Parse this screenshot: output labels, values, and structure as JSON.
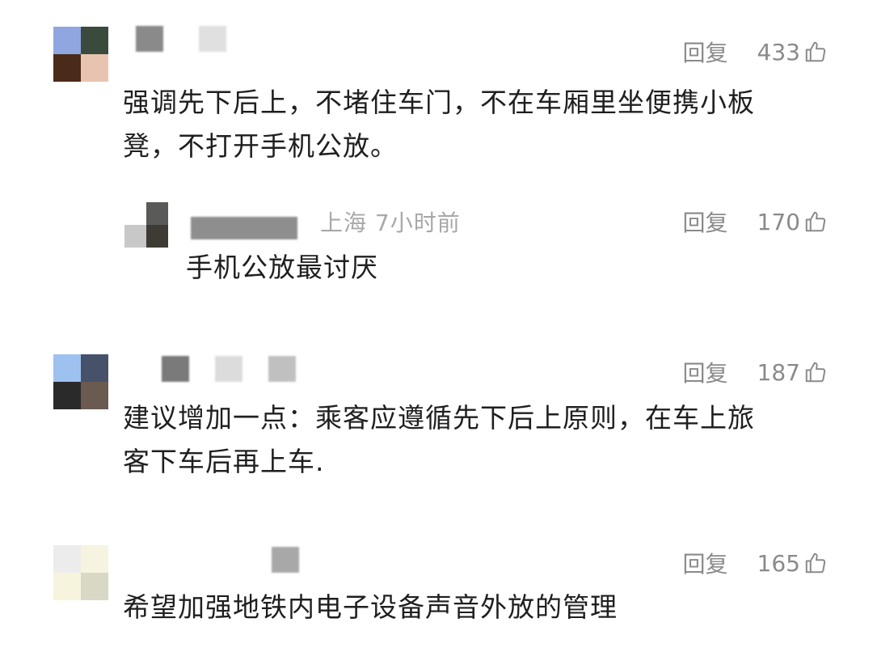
{
  "comments": [
    {
      "reply_label": "回复",
      "likes": "433",
      "lines": [
        "强调先下后上，不堵住车门，不在车厢里坐便携小板",
        "凳，不打开手机公放。"
      ],
      "replies": [
        {
          "location_time": "上海 7小时前",
          "reply_label": "回复",
          "likes": "170",
          "lines": [
            "手机公放最讨厌"
          ]
        }
      ]
    },
    {
      "reply_label": "回复",
      "likes": "187",
      "lines": [
        "建议增加一点：乘客应遵循先下后上原则，在车上旅",
        "客下车后再上车."
      ]
    },
    {
      "reply_label": "回复",
      "likes": "165",
      "lines": [
        "希望加强地铁内电子设备声音外放的管理"
      ]
    }
  ],
  "icons": {
    "like": "thumbs-up-icon"
  },
  "colors": {
    "text": "#1f1f1f",
    "meta": "#a8a8a8",
    "action": "#8a8a8a"
  }
}
